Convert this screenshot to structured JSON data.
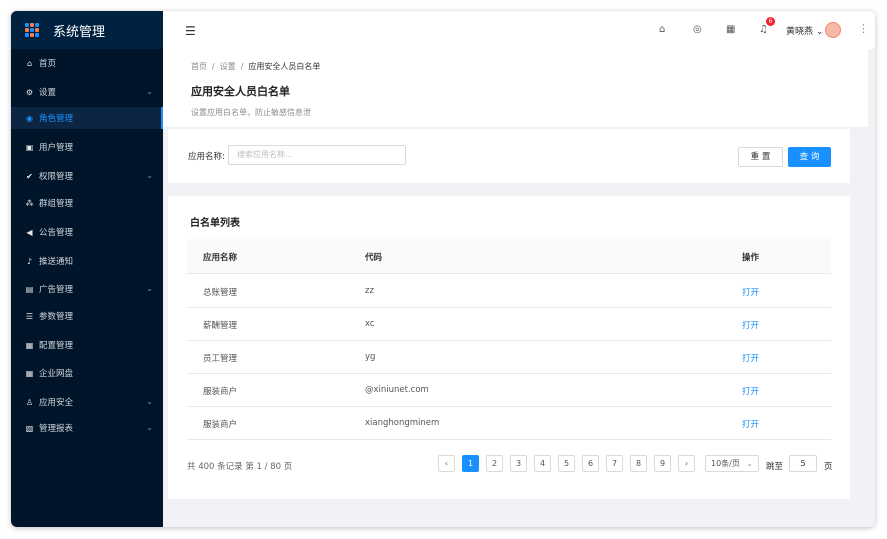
{
  "sidebar": {
    "title": "系统管理",
    "items": [
      {
        "label": "首页",
        "icon": "home-icon",
        "glyph": "⌂",
        "has_children": false,
        "active": false
      },
      {
        "label": "设置",
        "icon": "gear-icon",
        "glyph": "⚙",
        "has_children": true,
        "active": false
      },
      {
        "label": "角色管理",
        "icon": "user-circle-icon",
        "glyph": "◉",
        "has_children": false,
        "active": true
      },
      {
        "label": "用户管理",
        "icon": "user-card-icon",
        "glyph": "▣",
        "has_children": false,
        "active": false
      },
      {
        "label": "权限管理",
        "icon": "shield-check-icon",
        "glyph": "✔",
        "has_children": true,
        "active": false
      },
      {
        "label": "群组管理",
        "icon": "group-icon",
        "glyph": "⁂",
        "has_children": false,
        "active": false
      },
      {
        "label": "公告管理",
        "icon": "megaphone-icon",
        "glyph": "◀",
        "has_children": false,
        "active": false
      },
      {
        "label": "推送通知",
        "icon": "bell-icon",
        "glyph": "♪",
        "has_children": false,
        "active": false
      },
      {
        "label": "广告管理",
        "icon": "ad-icon",
        "glyph": "▤",
        "has_children": true,
        "active": false
      },
      {
        "label": "参数管理",
        "icon": "list-icon",
        "glyph": "☰",
        "has_children": false,
        "active": false
      },
      {
        "label": "配置管理",
        "icon": "config-icon",
        "glyph": "▦",
        "has_children": false,
        "active": false
      },
      {
        "label": "企业网盘",
        "icon": "grid-icon",
        "glyph": "▦",
        "has_children": false,
        "active": false
      },
      {
        "label": "应用安全",
        "icon": "thumb-icon",
        "glyph": "♙",
        "has_children": true,
        "active": false
      },
      {
        "label": "管理报表",
        "icon": "chart-icon",
        "glyph": "▧",
        "has_children": true,
        "active": false
      }
    ]
  },
  "header": {
    "notification_count": "6",
    "username": "黄晓燕"
  },
  "breadcrumb": {
    "home": "首页",
    "settings": "设置",
    "current": "应用安全人员白名单"
  },
  "page": {
    "title": "应用安全人员白名单",
    "description": "设置应用白名单，防止敏感信息泄"
  },
  "search": {
    "label": "应用名称",
    "colon": ":",
    "placeholder": "搜索应用名称...",
    "reset_label": "重 置",
    "query_label": "查 询"
  },
  "table": {
    "title": "白名单列表",
    "columns": {
      "name": "应用名称",
      "code": "代码",
      "action": "操作"
    },
    "rows": [
      {
        "name": "总账管理",
        "code": "zz",
        "action": "打开"
      },
      {
        "name": "薪酬管理",
        "code": "xc",
        "action": "打开"
      },
      {
        "name": "员工管理",
        "code": "yg",
        "action": "打开"
      },
      {
        "name": "服装商户",
        "code": "@xiniunet.com",
        "action": "打开"
      },
      {
        "name": "服装商户",
        "code": "xianghongminem",
        "action": "打开"
      }
    ]
  },
  "pagination": {
    "summary": "共 400 条记录 第 1 / 80 页",
    "prev": "‹",
    "next": "›",
    "pages": [
      "1",
      "2",
      "3",
      "4",
      "5",
      "6",
      "7",
      "8",
      "9"
    ],
    "current": "1",
    "page_size": "10条/页",
    "jump_label": "跳至",
    "jump_value": "5",
    "jump_unit": "页"
  },
  "colors": {
    "primary": "#1890ff",
    "sidebar_bg": "#001529",
    "badge": "#f5222d"
  }
}
